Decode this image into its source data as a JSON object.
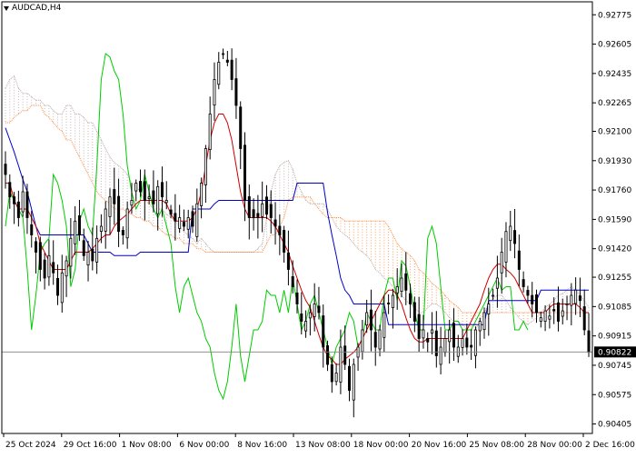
{
  "header": {
    "symbol_label": "AUDCAD,H4"
  },
  "colors": {
    "background": "#ffffff",
    "candle": "#000000",
    "price_line": "#808080",
    "price_box": "#000000",
    "tenkan": "#d00000",
    "kijun": "#0000c8",
    "chikou": "#00cc00",
    "cloud_a": "#ff8c40",
    "cloud_b": "#bca6a6"
  },
  "chart_data": {
    "type": "line",
    "subtype": "candlestick with ichimoku indicator",
    "title": "AUDCAD,H4",
    "ylim": [
      0.9035,
      0.9285
    ],
    "y_ticks": [
      0.92775,
      0.92605,
      0.92435,
      0.92265,
      0.921,
      0.9193,
      0.9176,
      0.9159,
      0.9142,
      0.91255,
      0.91085,
      0.90915,
      0.90745,
      0.90575,
      0.90405
    ],
    "x_labels": [
      "25 Oct 2024",
      "29 Oct 16:00",
      "1 Nov 08:00",
      "6 Nov 00:00",
      "8 Nov 16:00",
      "13 Nov 08:00",
      "18 Nov 00:00",
      "20 Nov 16:00",
      "25 Nov 08:00",
      "28 Nov 00:00",
      "2 Dec 16:00"
    ],
    "current_price": "0.90822",
    "bar_count": 135,
    "closes": [
      0.9185,
      0.9172,
      0.9168,
      0.916,
      0.9175,
      0.916,
      0.915,
      0.914,
      0.913,
      0.9125,
      0.9138,
      0.9128,
      0.9115,
      0.9128,
      0.9135,
      0.9148,
      0.9158,
      0.915,
      0.9138,
      0.914,
      0.9135,
      0.9148,
      0.9155,
      0.9165,
      0.9172,
      0.9168,
      0.9152,
      0.915,
      0.9165,
      0.917,
      0.918,
      0.9175,
      0.917,
      0.9172,
      0.9168,
      0.9178,
      0.9172,
      0.917,
      0.9162,
      0.9158,
      0.916,
      0.9155,
      0.916,
      0.9155,
      0.9168,
      0.918,
      0.92,
      0.922,
      0.924,
      0.925,
      0.9255,
      0.925,
      0.924,
      0.9225,
      0.92,
      0.917,
      0.916,
      0.916,
      0.916,
      0.9168,
      0.9162,
      0.916,
      0.9155,
      0.915,
      0.914,
      0.913,
      0.912,
      0.911,
      0.91,
      0.91,
      0.9105,
      0.911,
      0.9105,
      0.9085,
      0.9075,
      0.9065,
      0.907,
      0.9085,
      0.9075,
      0.906,
      0.9075,
      0.9085,
      0.9095,
      0.9105,
      0.9095,
      0.9085,
      0.9095,
      0.9105,
      0.911,
      0.9115,
      0.912,
      0.9125,
      0.9118,
      0.911,
      0.91,
      0.909,
      0.9095,
      0.9088,
      0.9095,
      0.908,
      0.9085,
      0.909,
      0.9095,
      0.9085,
      0.9085,
      0.909,
      0.9085,
      0.9085,
      0.9095,
      0.91,
      0.9105,
      0.911,
      0.9115,
      0.9125,
      0.914,
      0.9152,
      0.9155,
      0.9145,
      0.913,
      0.912,
      0.9115,
      0.911,
      0.9105,
      0.9102,
      0.9106,
      0.9103,
      0.9106,
      0.91,
      0.9106,
      0.911,
      0.9115,
      0.9118,
      0.9112,
      0.9095,
      0.9082
    ],
    "series": [
      {
        "values": [
          0.918,
          0.918,
          0.917,
          0.9165,
          0.9165,
          0.9165,
          0.916,
          0.9155,
          0.9145,
          0.914,
          0.9135,
          0.913,
          0.913,
          0.913,
          0.913,
          0.9135,
          0.914,
          0.914,
          0.914,
          0.914,
          0.9142,
          0.9145,
          0.9148,
          0.915,
          0.915,
          0.9155,
          0.9158,
          0.916,
          0.9162,
          0.9165,
          0.9168,
          0.917,
          0.917,
          0.917,
          0.917,
          0.917,
          0.917,
          0.9168,
          0.9162,
          0.9158,
          0.9158,
          0.9158,
          0.9158,
          0.916,
          0.9165,
          0.9175,
          0.919,
          0.9205,
          0.9215,
          0.922,
          0.922,
          0.9215,
          0.9205,
          0.919,
          0.9175,
          0.9165,
          0.916,
          0.916,
          0.916,
          0.916,
          0.916,
          0.9158,
          0.9155,
          0.915,
          0.9145,
          0.914,
          0.9132,
          0.9125,
          0.9118,
          0.9112,
          0.9108,
          0.91,
          0.9092,
          0.9085,
          0.908,
          0.9078,
          0.9075,
          0.9075,
          0.9078,
          0.908,
          0.9082,
          0.9085,
          0.909,
          0.9095,
          0.91,
          0.9105,
          0.911,
          0.9115,
          0.9118,
          0.9118,
          0.9115,
          0.911,
          0.9102,
          0.9095,
          0.909,
          0.9088,
          0.9088,
          0.909,
          0.909,
          0.909,
          0.909,
          0.909,
          0.909,
          0.909,
          0.909,
          0.909,
          0.9095,
          0.91,
          0.9105,
          0.911,
          0.9118,
          0.9125,
          0.913,
          0.9133,
          0.9133,
          0.913,
          0.9128,
          0.9125,
          0.912,
          0.9115,
          0.911,
          0.9105,
          0.9105,
          0.9105,
          0.9105,
          0.9108,
          0.911,
          0.911,
          0.911,
          0.911,
          0.911,
          0.911,
          0.9108,
          0.9105,
          0.9105
        ]
      },
      {
        "values": [
          0.9212,
          0.9205,
          0.9198,
          0.919,
          0.9182,
          0.9175,
          0.9165,
          0.9155,
          0.915,
          0.915,
          0.915,
          0.915,
          0.915,
          0.915,
          0.915,
          0.915,
          0.915,
          0.915,
          0.915,
          0.9145,
          0.914,
          0.914,
          0.914,
          0.914,
          0.914,
          0.9138,
          0.9138,
          0.9138,
          0.9138,
          0.9138,
          0.9138,
          0.914,
          0.914,
          0.914,
          0.914,
          0.914,
          0.914,
          0.914,
          0.914,
          0.914,
          0.914,
          0.914,
          0.914,
          0.9165,
          0.9165,
          0.9165,
          0.9165,
          0.9165,
          0.9168,
          0.917,
          0.917,
          0.917,
          0.917,
          0.917,
          0.917,
          0.917,
          0.917,
          0.917,
          0.917,
          0.917,
          0.917,
          0.917,
          0.917,
          0.917,
          0.917,
          0.917,
          0.917,
          0.918,
          0.918,
          0.918,
          0.918,
          0.918,
          0.918,
          0.918,
          0.9163,
          0.915,
          0.9138,
          0.9125,
          0.9118,
          0.9115,
          0.911,
          0.911,
          0.911,
          0.911,
          0.911,
          0.911,
          0.911,
          0.911,
          0.9098,
          0.9098,
          0.9098,
          0.9098,
          0.9098,
          0.9098,
          0.9098,
          0.9098,
          0.9098,
          0.9098,
          0.9098,
          0.9098,
          0.9098,
          0.9098,
          0.9098,
          0.9098,
          0.9098,
          0.9098,
          0.9098,
          0.9098,
          0.9098,
          0.9098,
          0.9098,
          0.9112,
          0.9112,
          0.9112,
          0.9112,
          0.9112,
          0.9112,
          0.9112,
          0.9112,
          0.9112,
          0.9112,
          0.9112,
          0.9112,
          0.9118,
          0.9118,
          0.9118,
          0.9118,
          0.9118,
          0.9118,
          0.9118,
          0.9118,
          0.9118,
          0.9118,
          0.9118,
          0.9118
        ]
      },
      {
        "values": [
          0.9155,
          0.9175,
          0.917,
          0.9165,
          0.916,
          0.913,
          0.9095,
          0.9115,
          0.914,
          0.9145,
          0.9148,
          0.9185,
          0.918,
          0.917,
          0.9155,
          0.912,
          0.913,
          0.9158,
          0.9165,
          0.9155,
          0.915,
          0.919,
          0.924,
          0.9255,
          0.9253,
          0.9245,
          0.924,
          0.922,
          0.919,
          0.9175,
          0.9165,
          0.917,
          0.9185,
          0.9175,
          0.9165,
          0.916,
          0.9165,
          0.9155,
          0.9145,
          0.912,
          0.9105,
          0.912,
          0.9125,
          0.9115,
          0.9105,
          0.91,
          0.909,
          0.9085,
          0.907,
          0.906,
          0.9055,
          0.9065,
          0.9085,
          0.911,
          0.908,
          0.9065,
          0.908,
          0.9095,
          0.9095,
          0.91,
          0.9118,
          0.9115,
          0.9115,
          0.9105,
          0.9118,
          0.9105,
          0.9125,
          0.911,
          0.9095,
          0.91,
          0.911,
          0.9115,
          0.9105,
          0.9095,
          0.9085,
          0.9075,
          0.9085,
          0.909,
          0.9095,
          0.9105,
          0.91,
          0.9085,
          0.909,
          0.9105,
          0.91,
          0.9095,
          0.9095,
          0.9115,
          0.9125,
          0.9125,
          0.9112,
          0.9135,
          0.9132,
          0.912,
          0.9105,
          0.9095,
          0.9095,
          0.9148,
          0.9155,
          0.9145,
          0.912,
          0.9095,
          0.9095,
          0.91,
          0.91,
          0.9095,
          0.9095,
          0.9095,
          0.91,
          0.9105,
          0.911,
          0.9115,
          0.912,
          0.9125,
          0.9118,
          0.912,
          0.912,
          0.9095,
          0.9095,
          0.91,
          0.9095
        ]
      },
      {
        "values": [
          0.9235,
          0.924,
          0.9242,
          0.9235,
          0.9232,
          0.9232,
          0.923,
          0.9228,
          0.9228,
          0.9225,
          0.9225,
          0.9222,
          0.922,
          0.922,
          0.9225,
          0.9225,
          0.922,
          0.922,
          0.9218,
          0.9215,
          0.9215,
          0.921,
          0.9205,
          0.92,
          0.9195,
          0.9192,
          0.919,
          0.9188,
          0.9185,
          0.918,
          0.9178,
          0.9175,
          0.917,
          0.9168,
          0.9165,
          0.9165,
          0.9165,
          0.9162,
          0.916,
          0.9158,
          0.9155,
          0.9152,
          0.915,
          0.9148,
          0.9145,
          0.9148,
          0.9145,
          0.9142,
          0.914,
          0.914,
          0.914,
          0.914,
          0.914,
          0.914,
          0.914,
          0.914,
          0.914,
          0.914,
          0.9142,
          0.9145,
          0.916,
          0.9175,
          0.9185,
          0.919,
          0.9192,
          0.9193,
          0.9188,
          0.918,
          0.9175,
          0.917,
          0.9168,
          0.9168,
          0.9168,
          0.9168,
          0.9165,
          0.916,
          0.9155,
          0.9152,
          0.915,
          0.9148,
          0.9145,
          0.9142,
          0.914,
          0.9138,
          0.9135,
          0.913,
          0.9128,
          0.9125,
          0.9123,
          0.912,
          0.9118,
          0.9115,
          0.9112,
          0.911,
          0.9108,
          0.9105,
          0.9105,
          0.9108,
          0.911,
          0.911,
          0.9108,
          0.9105,
          0.9102,
          0.91,
          0.91,
          0.9098,
          0.9095,
          0.9095,
          0.9095,
          0.91,
          0.9105,
          0.911,
          0.9113,
          0.9115,
          0.9115,
          0.9112,
          0.9108,
          0.9105,
          0.9102,
          0.91,
          0.9098,
          0.91,
          0.9102,
          0.9105,
          0.9108,
          0.911,
          0.9112,
          0.9115,
          0.9116,
          0.9118,
          0.912,
          0.9118,
          0.9115,
          0.9112,
          0.9108
        ]
      },
      {
        "values": [
          0.9215,
          0.9215,
          0.9218,
          0.922,
          0.9222,
          0.9222,
          0.9225,
          0.9225,
          0.9225,
          0.922,
          0.9218,
          0.9215,
          0.9212,
          0.921,
          0.9205,
          0.9205,
          0.92,
          0.9195,
          0.919,
          0.9185,
          0.918,
          0.9175,
          0.9172,
          0.917,
          0.9168,
          0.9165,
          0.9165,
          0.9165,
          0.9163,
          0.9162,
          0.916,
          0.916,
          0.9158,
          0.9158,
          0.9155,
          0.9155,
          0.9152,
          0.915,
          0.915,
          0.9148,
          0.9148,
          0.9145,
          0.9145,
          0.9145,
          0.9142,
          0.9142,
          0.914,
          0.914,
          0.914,
          0.914,
          0.914,
          0.914,
          0.914,
          0.914,
          0.914,
          0.914,
          0.914,
          0.914,
          0.914,
          0.914,
          0.9145,
          0.915,
          0.915,
          0.9155,
          0.916,
          0.917,
          0.9172,
          0.9172,
          0.9172,
          0.9172,
          0.9172,
          0.9168,
          0.9165,
          0.9162,
          0.916,
          0.916,
          0.916,
          0.916,
          0.9158,
          0.9158,
          0.9158,
          0.9158,
          0.9158,
          0.9158,
          0.9158,
          0.9158,
          0.9158,
          0.9158,
          0.9155,
          0.915,
          0.9145,
          0.9142,
          0.914,
          0.9138,
          0.9135,
          0.913,
          0.9128,
          0.9125,
          0.9122,
          0.912,
          0.9118,
          0.9115,
          0.9112,
          0.911,
          0.9108,
          0.9105,
          0.9105,
          0.9105,
          0.9105,
          0.9105,
          0.9105,
          0.9105,
          0.9105,
          0.9105,
          0.9105,
          0.9105,
          0.9105,
          0.9105,
          0.9105,
          0.9105,
          0.9105,
          0.9105,
          0.9105,
          0.9105,
          0.9105,
          0.9105,
          0.9105,
          0.9105,
          0.9105,
          0.9105,
          0.9105,
          0.9105,
          0.9105,
          0.9105,
          0.9105
        ]
      }
    ]
  }
}
